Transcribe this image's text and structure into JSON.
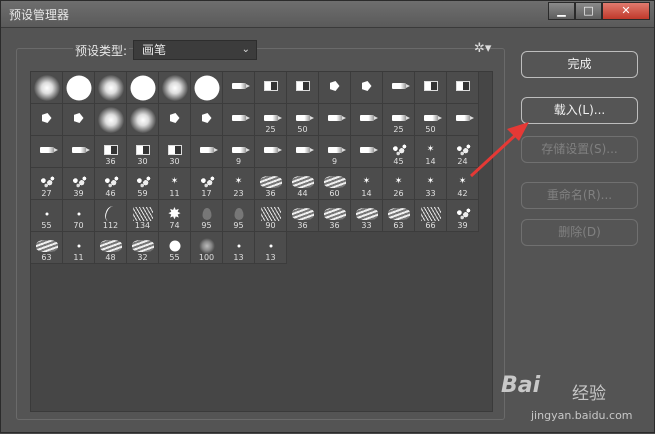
{
  "window": {
    "title": "预设管理器"
  },
  "window_controls": {
    "minimize": "▁",
    "maximize": "□",
    "close": "✕"
  },
  "preset_type": {
    "label": "预设类型:",
    "value": "画笔"
  },
  "buttons": {
    "done": "完成",
    "load": "载入(L)...",
    "save_set": "存储设置(S)...",
    "rename": "重命名(R)...",
    "delete": "删除(D)"
  },
  "brushes": [
    {
      "kind": "soft-round",
      "label": ""
    },
    {
      "kind": "hard-round",
      "label": ""
    },
    {
      "kind": "soft-round",
      "label": ""
    },
    {
      "kind": "hard-round",
      "label": ""
    },
    {
      "kind": "soft-round",
      "label": ""
    },
    {
      "kind": "hard-round",
      "label": ""
    },
    {
      "kind": "tool-a",
      "label": ""
    },
    {
      "kind": "tool-b",
      "label": ""
    },
    {
      "kind": "tool-b",
      "label": ""
    },
    {
      "kind": "tool-c",
      "label": ""
    },
    {
      "kind": "tool-c",
      "label": ""
    },
    {
      "kind": "tool-a",
      "label": ""
    },
    {
      "kind": "tool-b",
      "label": ""
    },
    {
      "kind": "tool-b",
      "label": ""
    },
    {
      "kind": "tool-c",
      "label": ""
    },
    {
      "kind": "tool-c",
      "label": ""
    },
    {
      "kind": "soft-round",
      "label": ""
    },
    {
      "kind": "soft-round",
      "label": ""
    },
    {
      "kind": "tool-c",
      "label": ""
    },
    {
      "kind": "tool-c",
      "label": ""
    },
    {
      "kind": "tool-a",
      "label": ""
    },
    {
      "kind": "tool-a",
      "label": "25"
    },
    {
      "kind": "tool-a",
      "label": "50"
    },
    {
      "kind": "tool-a",
      "label": ""
    },
    {
      "kind": "tool-a",
      "label": ""
    },
    {
      "kind": "tool-a",
      "label": "25"
    },
    {
      "kind": "tool-a",
      "label": "50"
    },
    {
      "kind": "tool-a",
      "label": ""
    },
    {
      "kind": "tool-a",
      "label": ""
    },
    {
      "kind": "tool-a",
      "label": ""
    },
    {
      "kind": "tool-b",
      "label": "36"
    },
    {
      "kind": "tool-b",
      "label": "30"
    },
    {
      "kind": "tool-b",
      "label": "30"
    },
    {
      "kind": "tool-a",
      "label": ""
    },
    {
      "kind": "tool-a",
      "label": "9"
    },
    {
      "kind": "tool-a",
      "label": ""
    },
    {
      "kind": "tool-a",
      "label": ""
    },
    {
      "kind": "tool-a",
      "label": "9"
    },
    {
      "kind": "tool-a",
      "label": ""
    },
    {
      "kind": "splat",
      "label": "45"
    },
    {
      "kind": "star",
      "label": "14"
    },
    {
      "kind": "splat",
      "label": "24"
    },
    {
      "kind": "splat",
      "label": "27"
    },
    {
      "kind": "splat",
      "label": "39"
    },
    {
      "kind": "splat",
      "label": "46"
    },
    {
      "kind": "splat",
      "label": "59"
    },
    {
      "kind": "star",
      "label": "11"
    },
    {
      "kind": "splat",
      "label": "17"
    },
    {
      "kind": "star",
      "label": "23"
    },
    {
      "kind": "streak",
      "label": "36"
    },
    {
      "kind": "streak",
      "label": "44"
    },
    {
      "kind": "streak",
      "label": "60"
    },
    {
      "kind": "star",
      "label": "14"
    },
    {
      "kind": "star",
      "label": "26"
    },
    {
      "kind": "star",
      "label": "33"
    },
    {
      "kind": "star",
      "label": "42"
    },
    {
      "kind": "dot",
      "label": "55"
    },
    {
      "kind": "dot",
      "label": "70"
    },
    {
      "kind": "blade",
      "label": "112"
    },
    {
      "kind": "grass",
      "label": "134"
    },
    {
      "kind": "leaf",
      "label": "74"
    },
    {
      "kind": "drop",
      "label": "95"
    },
    {
      "kind": "drop",
      "label": "95"
    },
    {
      "kind": "grass",
      "label": "90"
    },
    {
      "kind": "streak",
      "label": "36"
    },
    {
      "kind": "streak",
      "label": "36"
    },
    {
      "kind": "streak",
      "label": "33"
    },
    {
      "kind": "streak",
      "label": "63"
    },
    {
      "kind": "grass",
      "label": "66"
    },
    {
      "kind": "splat",
      "label": "39"
    },
    {
      "kind": "streak",
      "label": "63"
    },
    {
      "kind": "dot",
      "label": "11"
    },
    {
      "kind": "streak",
      "label": "48"
    },
    {
      "kind": "streak",
      "label": "32"
    },
    {
      "kind": "hard-small",
      "label": "55"
    },
    {
      "kind": "noise",
      "label": "100"
    },
    {
      "kind": "dot",
      "label": "13"
    },
    {
      "kind": "dot",
      "label": "13"
    }
  ],
  "watermark": {
    "logo": "Bai",
    "logo2": "经验",
    "url": "jingyan.baidu.com"
  },
  "colors": {
    "arrow": "#e53935"
  }
}
